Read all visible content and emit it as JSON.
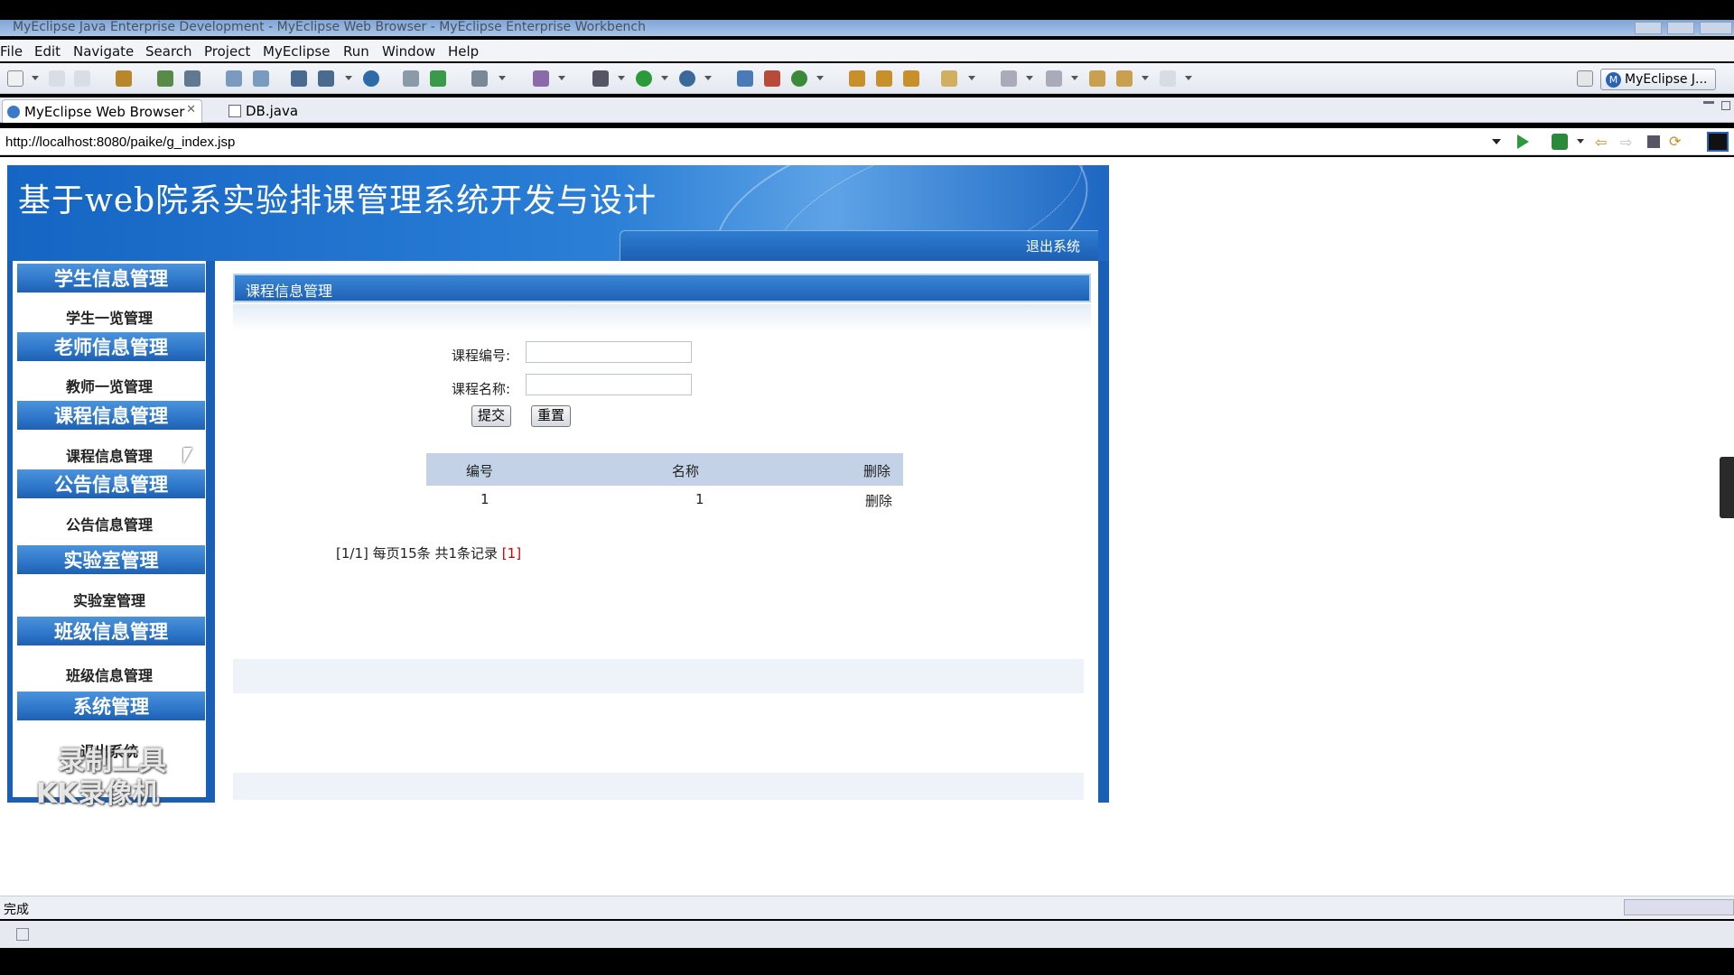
{
  "window": {
    "title": "MyEclipse Java Enterprise Development - MyEclipse Web Browser - MyEclipse Enterprise Workbench"
  },
  "menu": [
    "File",
    "Edit",
    "Navigate",
    "Search",
    "Project",
    "MyEclipse",
    "Run",
    "Window",
    "Help"
  ],
  "perspective": {
    "label": "MyEclipse J..."
  },
  "tabs": [
    {
      "label": "MyEclipse Web Browser",
      "active": true
    },
    {
      "label": "DB.java",
      "active": false
    }
  ],
  "address": {
    "url": "http://localhost:8080/paike/g_index.jsp"
  },
  "site": {
    "title": "基于web院系实验排课管理系统开发与设计",
    "logout": "退出系统"
  },
  "sidebar": {
    "sections": [
      {
        "title": "学生信息管理",
        "item": "学生一览管理"
      },
      {
        "title": "老师信息管理",
        "item": "教师一览管理"
      },
      {
        "title": "课程信息管理",
        "item": "课程信息管理"
      },
      {
        "title": "公告信息管理",
        "item": "公告信息管理"
      },
      {
        "title": "实验室管理",
        "item": "实验室管理"
      },
      {
        "title": "班级信息管理",
        "item": "班级信息管理"
      },
      {
        "title": "系统管理",
        "item": "退出系统"
      }
    ]
  },
  "panel": {
    "title": "课程信息管理",
    "form": {
      "code_label": "课程编号:",
      "name_label": "课程名称:",
      "code_value": "",
      "name_value": "",
      "submit": "提交",
      "reset": "重置"
    },
    "table": {
      "headers": [
        "编号",
        "名称",
        "删除"
      ],
      "rows": [
        [
          "1",
          "1",
          "删除"
        ]
      ]
    },
    "pager": {
      "text": "[1/1] 每页15条 共1条记录",
      "link": "[1]"
    }
  },
  "status": {
    "text": "完成"
  },
  "watermark": {
    "line1": "录制工具",
    "line2": "KK录像机"
  },
  "colors": {
    "brand_blue": "#1a5fb6",
    "header_blue": "#2b7fd6",
    "table_head": "#c3d2e6"
  }
}
